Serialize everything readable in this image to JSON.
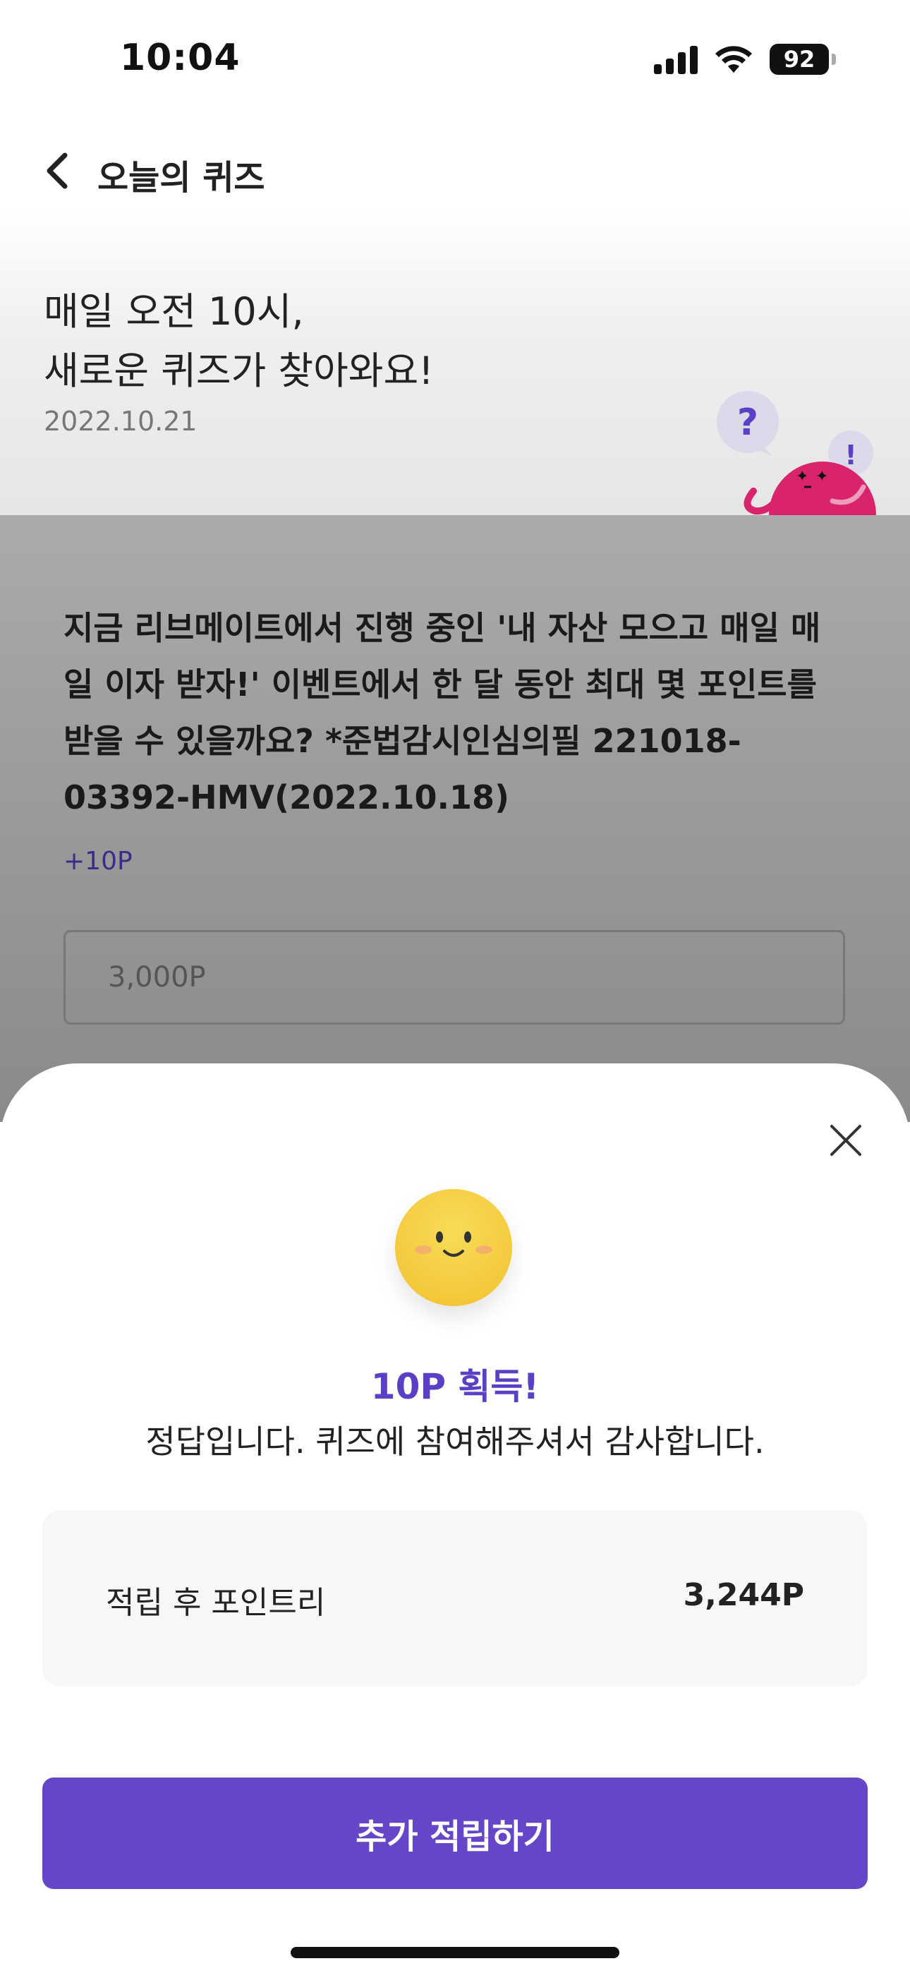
{
  "status_bar": {
    "time": "10:04",
    "battery": "92"
  },
  "nav": {
    "title": "오늘의 퀴즈"
  },
  "hero": {
    "title_line1": "매일 오전 10시,",
    "title_line2": "새로운 퀴즈가 찾아와요!",
    "date": "2022.10.21",
    "mascot_question_mark": "?",
    "mascot_exclamation": "!"
  },
  "question": {
    "text": "지금 리브메이트에서 진행 중인 '내 자산 모으고 매일 매일 이자 받자!' 이벤트에서 한 달 동안 최대 몇 포인트를 받을 수 있을까요? *준법감시인심의필 221018-03392-HMV(2022.10.18)",
    "points": "+10P",
    "answer_value": "3,000P"
  },
  "sheet": {
    "success_title": "10P 획득!",
    "success_message": "정답입니다. 퀴즈에 참여해주셔서 감사합니다.",
    "points_label": "적립 후 포인트리",
    "points_value": "3,244P",
    "cta_label": "추가 적립하기"
  },
  "colors": {
    "accent": "#6545c8",
    "accent_text": "#5b3fc4",
    "mascot": "#d9246b",
    "emoji": "#f4c93c"
  }
}
